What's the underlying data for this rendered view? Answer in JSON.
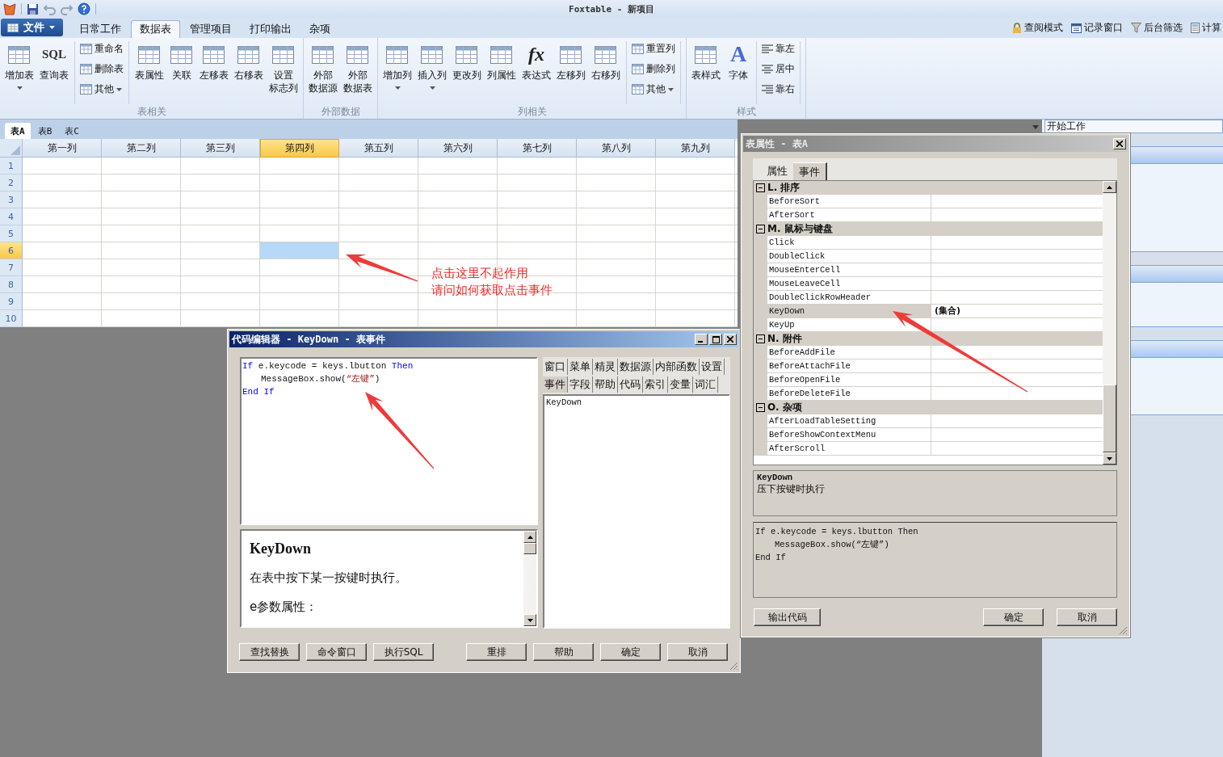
{
  "window": {
    "title": "Foxtable - 新项目"
  },
  "file_menu": {
    "label": "文件"
  },
  "ribbon_tabs": [
    {
      "label": "日常工作",
      "selected": false
    },
    {
      "label": "数据表",
      "selected": true
    },
    {
      "label": "管理项目",
      "selected": false
    },
    {
      "label": "打印输出",
      "selected": false
    },
    {
      "label": "杂项",
      "selected": false
    }
  ],
  "quick_links": [
    {
      "label": "查阅模式"
    },
    {
      "label": "记录窗口"
    },
    {
      "label": "后台筛选"
    },
    {
      "label": "计算"
    }
  ],
  "ribbon_groups": [
    {
      "title": "表相关",
      "items": [
        {
          "kind": "large",
          "lines": [
            "增加表"
          ],
          "dropdown": true
        },
        {
          "kind": "large",
          "lines": [
            "查询表"
          ],
          "icon_text": "SQL",
          "dropdown": false
        },
        {
          "kind": "stack",
          "entries": [
            {
              "label": "重命名",
              "dropdown": false
            },
            {
              "label": "删除表",
              "dropdown": false
            },
            {
              "label": "其他",
              "dropdown": true
            }
          ]
        },
        {
          "kind": "large",
          "lines": [
            "表属性"
          ],
          "dropdown": false
        },
        {
          "kind": "large",
          "lines": [
            "关联"
          ],
          "dropdown": false
        },
        {
          "kind": "large",
          "lines": [
            "左移表"
          ],
          "dropdown": false
        },
        {
          "kind": "large",
          "lines": [
            "右移表"
          ],
          "dropdown": false
        },
        {
          "kind": "large",
          "lines": [
            "设置",
            "标志列"
          ],
          "dropdown": false
        }
      ]
    },
    {
      "title": "外部数据",
      "items": [
        {
          "kind": "large",
          "lines": [
            "外部",
            "数据源"
          ],
          "dropdown": false
        },
        {
          "kind": "large",
          "lines": [
            "外部",
            "数据表"
          ],
          "dropdown": false
        }
      ]
    },
    {
      "title": "列相关",
      "items": [
        {
          "kind": "large",
          "lines": [
            "增加列"
          ],
          "dropdown": true
        },
        {
          "kind": "large",
          "lines": [
            "插入列"
          ],
          "dropdown": true
        },
        {
          "kind": "large",
          "lines": [
            "更改列"
          ],
          "dropdown": false
        },
        {
          "kind": "large",
          "lines": [
            "列属性"
          ],
          "dropdown": false
        },
        {
          "kind": "large",
          "lines": [
            "表达式"
          ],
          "icon_text": "fx",
          "dropdown": false
        },
        {
          "kind": "large",
          "lines": [
            "左移列"
          ],
          "dropdown": false
        },
        {
          "kind": "large",
          "lines": [
            "右移列"
          ],
          "dropdown": false
        },
        {
          "kind": "stack",
          "entries": [
            {
              "label": "重置列",
              "dropdown": false
            },
            {
              "label": "删除列",
              "dropdown": false
            },
            {
              "label": "其他",
              "dropdown": true
            }
          ]
        }
      ]
    },
    {
      "title": "样式",
      "items": [
        {
          "kind": "large",
          "lines": [
            "表样式"
          ],
          "dropdown": false
        },
        {
          "kind": "large",
          "lines": [
            "字体"
          ],
          "icon_text": "A",
          "dropdown": false
        },
        {
          "kind": "align_stack",
          "entries": [
            {
              "label": "靠左",
              "dropdown": false
            },
            {
              "label": "居中",
              "dropdown": false
            },
            {
              "label": "靠右",
              "dropdown": false
            }
          ]
        }
      ]
    }
  ],
  "sheet_tabs": [
    {
      "label": "表A",
      "selected": true
    },
    {
      "label": "表B",
      "selected": false
    },
    {
      "label": "表C",
      "selected": false
    }
  ],
  "grid": {
    "columns": [
      {
        "label": "第一列",
        "selected": false
      },
      {
        "label": "第二列",
        "selected": false
      },
      {
        "label": "第三列",
        "selected": false
      },
      {
        "label": "第四列",
        "selected": true
      },
      {
        "label": "第五列",
        "selected": false
      },
      {
        "label": "第六列",
        "selected": false
      },
      {
        "label": "第七列",
        "selected": false
      },
      {
        "label": "第八列",
        "selected": false
      },
      {
        "label": "第九列",
        "selected": false
      }
    ],
    "rows": [
      {
        "label": "1",
        "selected": false
      },
      {
        "label": "2",
        "selected": false
      },
      {
        "label": "3",
        "selected": false
      },
      {
        "label": "4",
        "selected": false
      },
      {
        "label": "5",
        "selected": false
      },
      {
        "label": "6",
        "selected": true
      },
      {
        "label": "7",
        "selected": false
      },
      {
        "label": "8",
        "selected": false
      },
      {
        "label": "9",
        "selected": false
      },
      {
        "label": "10",
        "selected": false
      }
    ]
  },
  "annotation": {
    "lines": [
      "点击这里不起作用",
      "请问如何获取点击事件"
    ]
  },
  "right_panel": {
    "field_value": "开始工作"
  },
  "code_editor": {
    "title": "代码编辑器 - KeyDown - 表事件",
    "code": [
      {
        "indent": false,
        "parts": [
          {
            "kind": "keyword",
            "text": "If"
          },
          {
            "kind": "plain",
            "text": " e.keycode = keys.lbutton "
          },
          {
            "kind": "keyword",
            "text": "Then"
          }
        ]
      },
      {
        "indent": true,
        "parts": [
          {
            "kind": "plain",
            "text": "MessageBox.show("
          },
          {
            "kind": "string",
            "text": "“左键”"
          },
          {
            "kind": "plain",
            "text": ")"
          }
        ]
      },
      {
        "indent": false,
        "parts": [
          {
            "kind": "keyword",
            "text": "End If"
          }
        ]
      }
    ],
    "help": {
      "title": "KeyDown",
      "text": "在表中按下某一按键时执行。",
      "params": "e参数属性："
    },
    "tab_rows": [
      [
        {
          "label": "窗口",
          "selected": false
        },
        {
          "label": "菜单",
          "selected": false
        },
        {
          "label": "精灵",
          "selected": false
        },
        {
          "label": "数据源",
          "selected": false
        },
        {
          "label": "内部函数",
          "selected": false
        },
        {
          "label": "设置",
          "selected": false
        }
      ],
      [
        {
          "label": "事件",
          "selected": true
        },
        {
          "label": "字段",
          "selected": false
        },
        {
          "label": "帮助",
          "selected": false
        },
        {
          "label": "代码",
          "selected": false
        },
        {
          "label": "索引",
          "selected": false
        },
        {
          "label": "变量",
          "selected": false
        },
        {
          "label": "词汇",
          "selected": false
        }
      ]
    ],
    "list": [
      "KeyDown"
    ],
    "left_buttons": [
      "查找替换",
      "命令窗口",
      "执行SQL"
    ],
    "right_buttons": [
      "重排",
      "帮助",
      "确定",
      "取消"
    ]
  },
  "property_dialog": {
    "title": "表属性 - 表A",
    "tabs": [
      {
        "label": "属性",
        "selected": false
      },
      {
        "label": "事件",
        "selected": true
      }
    ],
    "categories": [
      {
        "title": "L. 排序",
        "expanded": true,
        "items": [
          {
            "name": "BeforeSort",
            "selected": false
          },
          {
            "name": "AfterSort",
            "selected": false
          }
        ]
      },
      {
        "title": "M. 鼠标与键盘",
        "expanded": true,
        "items": [
          {
            "name": "Click",
            "selected": false
          },
          {
            "name": "DoubleClick",
            "selected": false
          },
          {
            "name": "MouseEnterCell",
            "selected": false
          },
          {
            "name": "MouseLeaveCell",
            "selected": false
          },
          {
            "name": "DoubleClickRowHeader",
            "selected": false
          },
          {
            "name": "KeyDown",
            "value": "(集合)",
            "selected": true
          },
          {
            "name": "KeyUp",
            "selected": false
          }
        ]
      },
      {
        "title": "N. 附件",
        "expanded": true,
        "items": [
          {
            "name": "BeforeAddFile",
            "selected": false
          },
          {
            "name": "BeforeAttachFile",
            "selected": false
          },
          {
            "name": "BeforeOpenFile",
            "selected": false
          },
          {
            "name": "BeforeDeleteFile",
            "selected": false
          }
        ]
      },
      {
        "title": "O. 杂项",
        "expanded": true,
        "items": [
          {
            "name": "AfterLoadTableSetting",
            "selected": false
          },
          {
            "name": "BeforeShowContextMenu",
            "selected": false
          },
          {
            "name": "AfterScroll",
            "selected": false
          }
        ]
      }
    ],
    "description": {
      "name": "KeyDown",
      "text": "压下按键时执行"
    },
    "preview": [
      {
        "indent": false,
        "text": "If e.keycode = keys.lbutton Then"
      },
      {
        "indent": true,
        "text": "MessageBox.show(“左键”)"
      },
      {
        "indent": false,
        "text": "End If"
      }
    ],
    "left_button": "输出代码",
    "right_buttons": [
      "确定",
      "取消"
    ]
  }
}
